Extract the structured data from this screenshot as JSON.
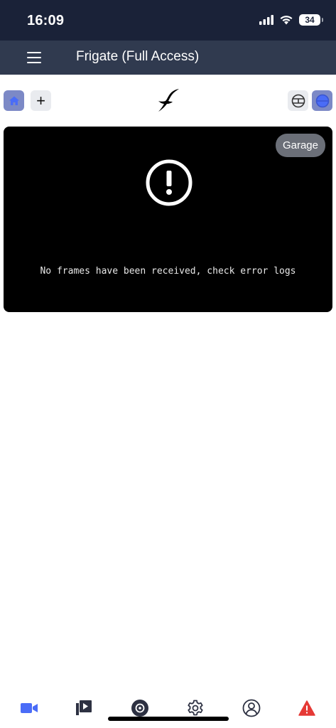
{
  "status_bar": {
    "time": "16:09",
    "battery": "34"
  },
  "app_bar": {
    "title": "Frigate (Full Access)"
  },
  "toolbar": {
    "add_label": "+"
  },
  "camera": {
    "name": "Garage",
    "error_message": "No frames have been received, check error logs"
  },
  "colors": {
    "accent": "#4a6cf7",
    "alert": "#e53935",
    "status_bar_bg": "#1a2238",
    "app_bar_bg": "#303a4f"
  },
  "bottom_nav": {
    "items": [
      "live-icon",
      "review-icon",
      "recordings-icon",
      "settings-icon",
      "account-icon",
      "alert-icon"
    ]
  }
}
